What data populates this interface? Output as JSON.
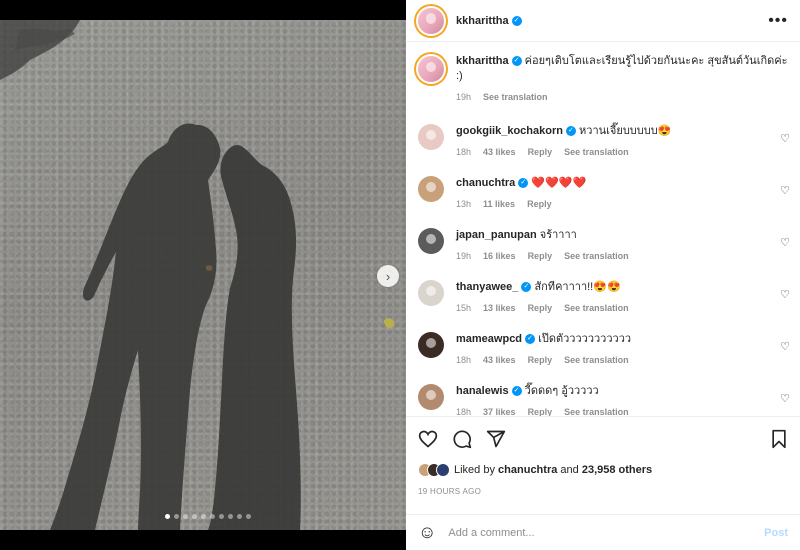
{
  "post": {
    "author": "kkharittha",
    "caption": "ค่อยๆเติบโตและเรียนรู้ไปด้วยกันนะคะ สุขสันต์วันเกิดค่ะ :)",
    "caption_time": "19h",
    "see_translation": "See translation"
  },
  "comments": [
    {
      "user": "gookgiik_kochakorn",
      "verified": true,
      "text": "หวานเจี๊ยบบบบบ",
      "emoji": "😍",
      "time": "18h",
      "likes": "43 likes",
      "reply": "Reply",
      "translation": "See translation",
      "avatar_color": "#e8c9c4"
    },
    {
      "user": "chanuchtra",
      "verified": true,
      "text": "",
      "emoji": "❤️❤️❤️❤️",
      "time": "13h",
      "likes": "11 likes",
      "reply": "Reply",
      "translation": "",
      "avatar_color": "#c8a07a"
    },
    {
      "user": "japan_panupan",
      "verified": false,
      "text": "จร้าาาา",
      "emoji": "",
      "time": "19h",
      "likes": "16 likes",
      "reply": "Reply",
      "translation": "See translation",
      "avatar_color": "#5b5b5b"
    },
    {
      "user": "thanyawee_",
      "verified": true,
      "text": "สักทีคาาาา!!",
      "emoji": "😍😍",
      "time": "15h",
      "likes": "13 likes",
      "reply": "Reply",
      "translation": "See translation",
      "avatar_color": "#d9d4cc"
    },
    {
      "user": "mameawpcd",
      "verified": true,
      "text": "เป๊ดตัววววววววววว",
      "emoji": "",
      "time": "18h",
      "likes": "43 likes",
      "reply": "Reply",
      "translation": "See translation",
      "avatar_color": "#3a2b25"
    },
    {
      "user": "hanalewis",
      "verified": true,
      "text": "วี๊ดดดๆ อู้ววววว",
      "emoji": "",
      "time": "18h",
      "likes": "37 likes",
      "reply": "Reply",
      "translation": "See translation",
      "avatar_color": "#b28a6d"
    }
  ],
  "likes": {
    "prefix": "Liked by",
    "user": "chanuchtra",
    "and": "and",
    "others": "23,958 others"
  },
  "timestamp": "19 HOURS AGO",
  "add_comment": {
    "placeholder": "Add a comment...",
    "post_label": "Post"
  },
  "icons": {
    "like": "heart-icon",
    "comment": "comment-icon",
    "share": "share-icon",
    "save": "bookmark-icon",
    "emoji": "smile-icon",
    "more": "more-icon",
    "next": "chevron-right-icon"
  },
  "colors": {
    "accent": "#0095f6",
    "post_disabled": "#b3dbff",
    "secondary_text": "#8e8e8e"
  },
  "carousel": {
    "count": 10,
    "active_index": 0
  }
}
